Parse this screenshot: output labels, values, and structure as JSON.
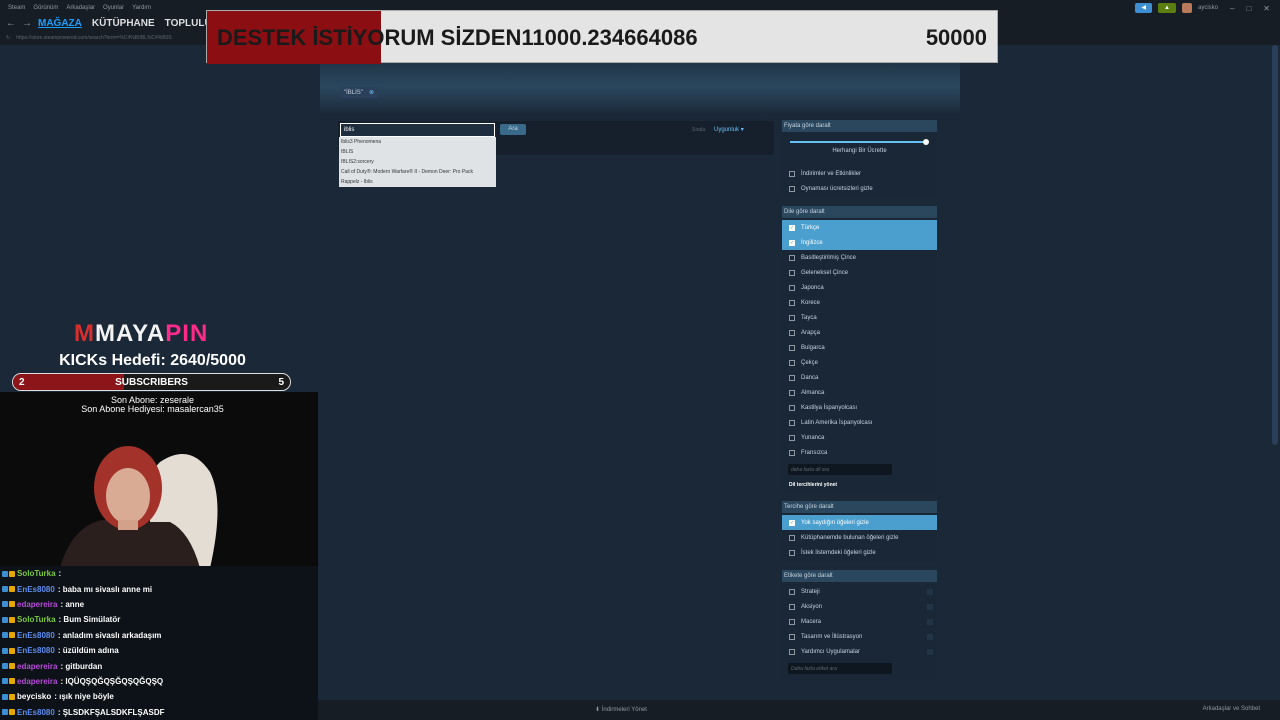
{
  "titlebar": {
    "menu": [
      "Steam",
      "Görünüm",
      "Arkadaşlar",
      "Oyunlar",
      "Yardım"
    ],
    "username": "aycisko"
  },
  "nav": {
    "tabs": [
      "MAĞAZA",
      "KÜTÜPHANE",
      "TOPLULUK"
    ],
    "url": "https://store.steampowered.com/search?term=%C4%B0BL%C4%B0S"
  },
  "overlay": {
    "text": "DESTEK İSTİYORUM SİZDEN11000.234664086",
    "value": "50000",
    "fill_fraction": 0.22
  },
  "search": {
    "tag": "\"İBLİS\"",
    "query": "iblis",
    "button": "Ara",
    "sort_label": "Sırala",
    "sort_value": "Uygunluk",
    "suggestions": [
      "Iblis3 Phenomena",
      "IBLIS",
      "IBLIS2:sorcery",
      "Call of Duty®: Modern Warfare® II - Demon Deer: Pro Pack",
      "Rappelz - Iblis"
    ]
  },
  "filters": {
    "price": {
      "title": "Fiyata göre daralt",
      "slider_label": "Herhangi Bir Ücrette",
      "options": [
        "İndirimler ve Etkinlikler",
        "Oynaması ücretsizleri gizle"
      ]
    },
    "language": {
      "title": "Dile göre daralt",
      "checked": [
        "Türkçe",
        "İngilizce"
      ],
      "options": [
        "Basitleştirilmiş Çince",
        "Geleneksel Çince",
        "Japonca",
        "Korece",
        "Tayca",
        "Arapça",
        "Bulgarca",
        "Çekçe",
        "Danca",
        "Almanca",
        "Kastilya İspanyolcası",
        "Latin Amerika İspanyolcası",
        "Yunanca",
        "Fransızca"
      ],
      "search_placeholder": "daha fazla dil ara",
      "manage_link": "Dil tercihlerini yönet"
    },
    "preference": {
      "title": "Tercihe göre daralt",
      "checked": [
        "Yok saydığın öğeleri gizle"
      ],
      "options": [
        "Kütüphanemde bulunan öğeleri gizle",
        "İstek listemdeki öğeleri gizle"
      ]
    },
    "tags": {
      "title": "Etikete göre daralt",
      "options": [
        "Strateji",
        "Aksiyon",
        "Macera",
        "Tasarım ve İllüstrasyon",
        "Yardımcı Uygulamalar"
      ],
      "search_placeholder": "Daha fazla etiket ara"
    }
  },
  "bottom": {
    "downloads": "İndirmeleri Yönet",
    "friends": "Arkadaşlar ve Sohbet"
  },
  "stream": {
    "logo_m": "M",
    "logo_text": "MAYA",
    "logo_pin": "PIN",
    "kicks": "KICKs Hedefi: 2640/5000",
    "sub_left": "2",
    "sub_title": "SUBSCRIBERS",
    "sub_right": "5",
    "sub_fraction": 0.4,
    "last_sub": "Son Abone: zeserale",
    "last_gift": "Son Abone Hediyesi: masalercan35"
  },
  "chat": [
    {
      "user": "SoloTurka",
      "color": "#7ac943",
      "msg": ":"
    },
    {
      "user": "EnEs8080",
      "color": "#5b8def",
      "msg": ": baba mı sivaslı anne mi"
    },
    {
      "user": "edapereira",
      "color": "#b44bd6",
      "msg": ": anne"
    },
    {
      "user": "SoloTurka",
      "color": "#7ac943",
      "msg": ": Bum Simülatör"
    },
    {
      "user": "EnEs8080",
      "color": "#5b8def",
      "msg": ": anladım sivaslı arkadaşım"
    },
    {
      "user": "EnEs8080",
      "color": "#5b8def",
      "msg": ": üzüldüm adına"
    },
    {
      "user": "edapereira",
      "color": "#b44bd6",
      "msg": ": gitburdan"
    },
    {
      "user": "edapereira",
      "color": "#b44bd6",
      "msg": ": IQÜQŞQĞQŞĞQŞQĞQŞQ"
    },
    {
      "user": "beycisko",
      "color": "#ffffff",
      "msg": ": ışık niye böyle"
    },
    {
      "user": "EnEs8080",
      "color": "#5b8def",
      "msg": ": ŞLSDKFŞALSDKFLŞASDF"
    }
  ]
}
